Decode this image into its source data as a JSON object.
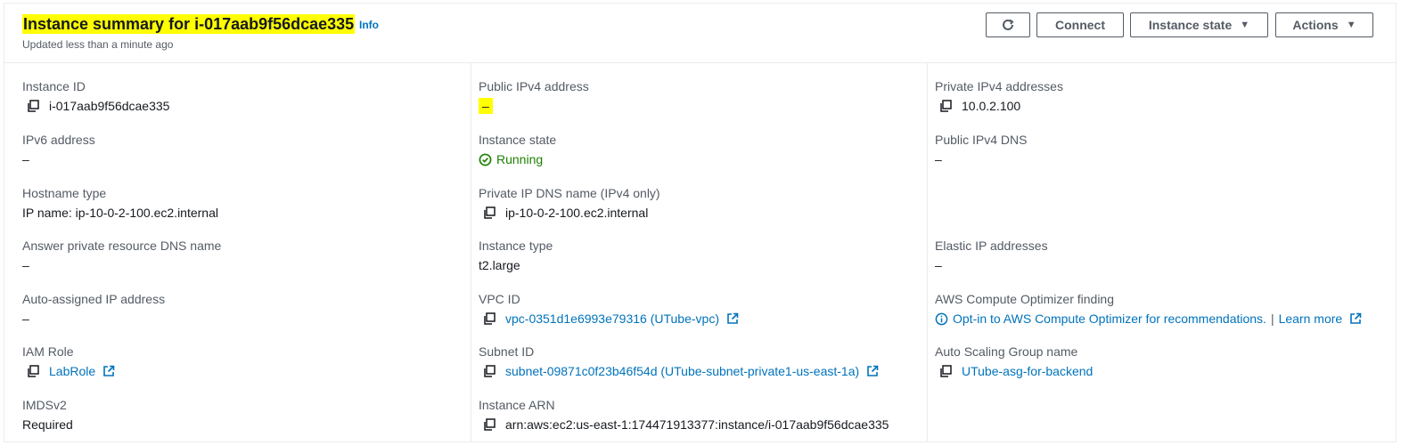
{
  "header": {
    "title": "Instance summary for i-017aab9f56dcae335",
    "info_label": "Info",
    "updated": "Updated less than a minute ago"
  },
  "buttons": {
    "connect": "Connect",
    "instance_state": "Instance state",
    "actions": "Actions"
  },
  "fields": {
    "instance_id": {
      "label": "Instance ID",
      "value": "i-017aab9f56dcae335"
    },
    "ipv6": {
      "label": "IPv6 address",
      "value": "–"
    },
    "hostname_type": {
      "label": "Hostname type",
      "value": "IP name: ip-10-0-2-100.ec2.internal"
    },
    "answer_dns": {
      "label": "Answer private resource DNS name",
      "value": "–"
    },
    "auto_ip": {
      "label": "Auto-assigned IP address",
      "value": "–"
    },
    "iam_role": {
      "label": "IAM Role",
      "value": "LabRole"
    },
    "imdsv2": {
      "label": "IMDSv2",
      "value": "Required"
    },
    "public_ipv4": {
      "label": "Public IPv4 address",
      "value": "–"
    },
    "instance_state": {
      "label": "Instance state",
      "value": "Running"
    },
    "private_dns": {
      "label": "Private IP DNS name (IPv4 only)",
      "value": "ip-10-0-2-100.ec2.internal"
    },
    "instance_type": {
      "label": "Instance type",
      "value": "t2.large"
    },
    "vpc_id": {
      "label": "VPC ID",
      "value": "vpc-0351d1e6993e79316 (UTube-vpc)"
    },
    "subnet_id": {
      "label": "Subnet ID",
      "value": "subnet-09871c0f23b46f54d (UTube-subnet-private1-us-east-1a)"
    },
    "instance_arn": {
      "label": "Instance ARN",
      "value": "arn:aws:ec2:us-east-1:174471913377:instance/i-017aab9f56dcae335"
    },
    "private_ipv4": {
      "label": "Private IPv4 addresses",
      "value": "10.0.2.100"
    },
    "public_dns": {
      "label": "Public IPv4 DNS",
      "value": "–"
    },
    "elastic_ip": {
      "label": "Elastic IP addresses",
      "value": "–"
    },
    "optimizer": {
      "label": "AWS Compute Optimizer finding",
      "value": "Opt-in to AWS Compute Optimizer for recommendations.",
      "separator": "|",
      "learn_more": "Learn more"
    },
    "asg": {
      "label": "Auto Scaling Group name",
      "value": "UTube-asg-for-backend"
    }
  },
  "colors": {
    "highlight": "#ffff00",
    "link": "#0073bb",
    "running": "#1d8102",
    "label": "#545b64"
  }
}
